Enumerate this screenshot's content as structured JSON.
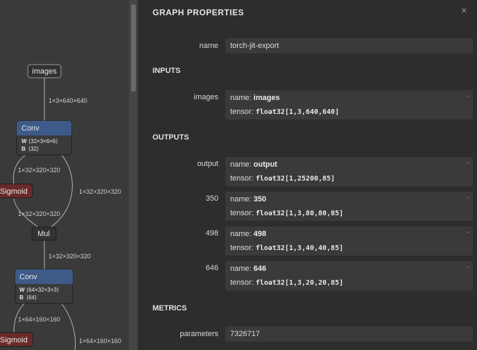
{
  "graph": {
    "nodes": {
      "images": "images",
      "conv1": "Conv",
      "conv1_w": "W",
      "conv1_w_shape": "⟨32×3×6×6⟩",
      "conv1_b": "B",
      "conv1_b_shape": "⟨32⟩",
      "sigmoid1": "Sigmoid",
      "mul1": "Mul",
      "conv2": "Conv",
      "conv2_w": "W",
      "conv2_w_shape": "⟨64×32×3×3⟩",
      "conv2_b": "B",
      "conv2_b_shape": "⟨64⟩",
      "sigmoid2": "Sigmoid"
    },
    "edges": {
      "e1": "1×3×640×640",
      "e2": "1×32×320×320",
      "e3": "1×32×320×320",
      "e4": "1×32×320×320",
      "e5": "1×32×320×320",
      "e6": "1×64×160×160",
      "e7": "1×64×160×160"
    }
  },
  "panel": {
    "title": "GRAPH PROPERTIES",
    "close_icon": "×",
    "name_label": "name",
    "name_value": "torch-jit-export",
    "inputs_head": "INPUTS",
    "inputs": [
      {
        "label": "images",
        "name_prefix": "name: ",
        "name": "images",
        "tensor_prefix": "tensor: ",
        "tensor": "float32[1,3,640,640]"
      }
    ],
    "outputs_head": "OUTPUTS",
    "outputs": [
      {
        "label": "output",
        "name_prefix": "name: ",
        "name": "output",
        "tensor_prefix": "tensor: ",
        "tensor": "float32[1,25200,85]"
      },
      {
        "label": "350",
        "name_prefix": "name: ",
        "name": "350",
        "tensor_prefix": "tensor: ",
        "tensor": "float32[1,3,80,80,85]"
      },
      {
        "label": "498",
        "name_prefix": "name: ",
        "name": "498",
        "tensor_prefix": "tensor: ",
        "tensor": "float32[1,3,40,40,85]"
      },
      {
        "label": "646",
        "name_prefix": "name: ",
        "name": "646",
        "tensor_prefix": "tensor: ",
        "tensor": "float32[1,3,20,20,85]"
      }
    ],
    "expand_icon": "-",
    "metrics_head": "METRICS",
    "parameters_label": "parameters",
    "parameters_value": "7326717"
  }
}
